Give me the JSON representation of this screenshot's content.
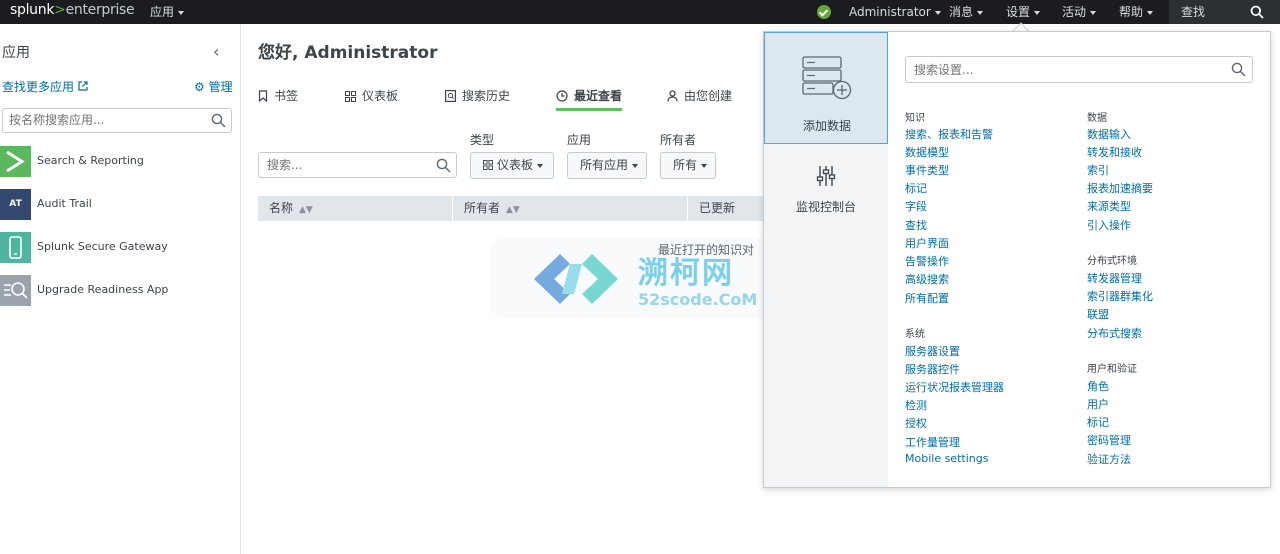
{
  "topbar": {
    "logo_main": "splunk",
    "logo_gt": ">",
    "logo_sub": "enterprise",
    "apps_menu": "应用",
    "user": "Administrator",
    "messages": "消息",
    "settings": "设置",
    "activity": "活动",
    "help": "帮助",
    "find": "查找"
  },
  "sidebar": {
    "title": "应用",
    "find_more": "查找更多应用",
    "manage": "管理",
    "search_placeholder": "按名称搜索应用...",
    "apps": [
      {
        "label": "Search & Reporting",
        "icon": "search-reporting-icon"
      },
      {
        "label": "Audit Trail",
        "icon": "audit-trail-icon",
        "badge": "AT"
      },
      {
        "label": "Splunk Secure Gateway",
        "icon": "secure-gateway-icon"
      },
      {
        "label": "Upgrade Readiness App",
        "icon": "upgrade-readiness-icon"
      }
    ]
  },
  "main": {
    "greeting": "您好, Administrator",
    "tabs": [
      {
        "label": "书签",
        "icon": "bookmark-icon"
      },
      {
        "label": "仪表板",
        "icon": "dashboard-icon"
      },
      {
        "label": "搜索历史",
        "icon": "search-history-icon"
      },
      {
        "label": "最近查看",
        "icon": "clock-icon",
        "active": true
      },
      {
        "label": "由您创建",
        "icon": "user-icon"
      }
    ],
    "filters": {
      "type_label": "类型",
      "app_label": "应用",
      "owner_label": "所有者",
      "search_placeholder": "搜索...",
      "type_value": "仪表板",
      "app_value": "所有应用",
      "owner_value": "所有"
    },
    "table": {
      "columns": [
        "名称",
        "所有者",
        "已更新"
      ]
    },
    "empty_message": "最近打开的知识对"
  },
  "watermark": {
    "text": "溯柯网",
    "sub": "52scode.CoM"
  },
  "settings_panel": {
    "add_data": "添加数据",
    "monitoring_console": "监视控制台",
    "search_placeholder": "搜索设置...",
    "knowledge": {
      "heading": "知识",
      "links": [
        "搜索、报表和告警",
        "数据模型",
        "事件类型",
        "标记",
        "字段",
        "查找",
        "用户界面",
        "告警操作",
        "高级搜索",
        "所有配置"
      ]
    },
    "system": {
      "heading": "系统",
      "links": [
        "服务器设置",
        "服务器控件",
        "运行状况报表管理器",
        "检测",
        "授权",
        "工作量管理",
        "Mobile settings"
      ]
    },
    "data": {
      "heading": "数据",
      "links": [
        "数据输入",
        "转发和接收",
        "索引",
        "报表加速摘要",
        "来源类型",
        "引入操作"
      ]
    },
    "distributed": {
      "heading": "分布式环境",
      "links": [
        "转发器管理",
        "索引器群集化",
        "联盟",
        "分布式搜索"
      ]
    },
    "users_auth": {
      "heading": "用户和验证",
      "links": [
        "角色",
        "用户",
        "标记",
        "密码管理",
        "验证方法"
      ]
    }
  }
}
